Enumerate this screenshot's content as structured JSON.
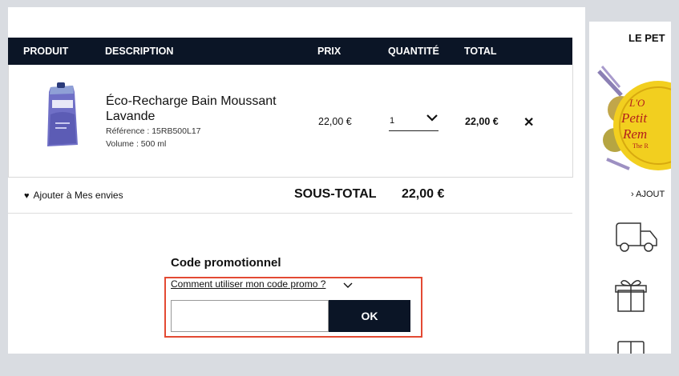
{
  "cart": {
    "columns": {
      "product": "PRODUIT",
      "description": "DESCRIPTION",
      "price": "PRIX",
      "quantity": "QUANTITÉ",
      "total": "TOTAL"
    },
    "item": {
      "name": "Éco-Recharge Bain Moussant Lavande",
      "reference": "Référence : 15RB500L17",
      "volume": "Volume : 500 ml",
      "price": "22,00 €",
      "quantity": "1",
      "total": "22,00 €",
      "remove_label": "✕"
    },
    "wishlist_label": "Ajouter à Mes envies",
    "subtotal_label": "SOUS-TOTAL",
    "subtotal_value": "22,00 €"
  },
  "promo": {
    "title": "Code promotionnel",
    "help_link": "Comment utiliser mon code promo ?",
    "input_value": "",
    "button_label": "OK"
  },
  "sidebar": {
    "title": "LE PET",
    "link": "› AJOUT",
    "icons": [
      "truck-icon",
      "gift-icon",
      "book-icon"
    ]
  },
  "colors": {
    "header_bg": "#0b1526",
    "highlight": "#e34a33",
    "page_bg": "#d9dce1"
  }
}
